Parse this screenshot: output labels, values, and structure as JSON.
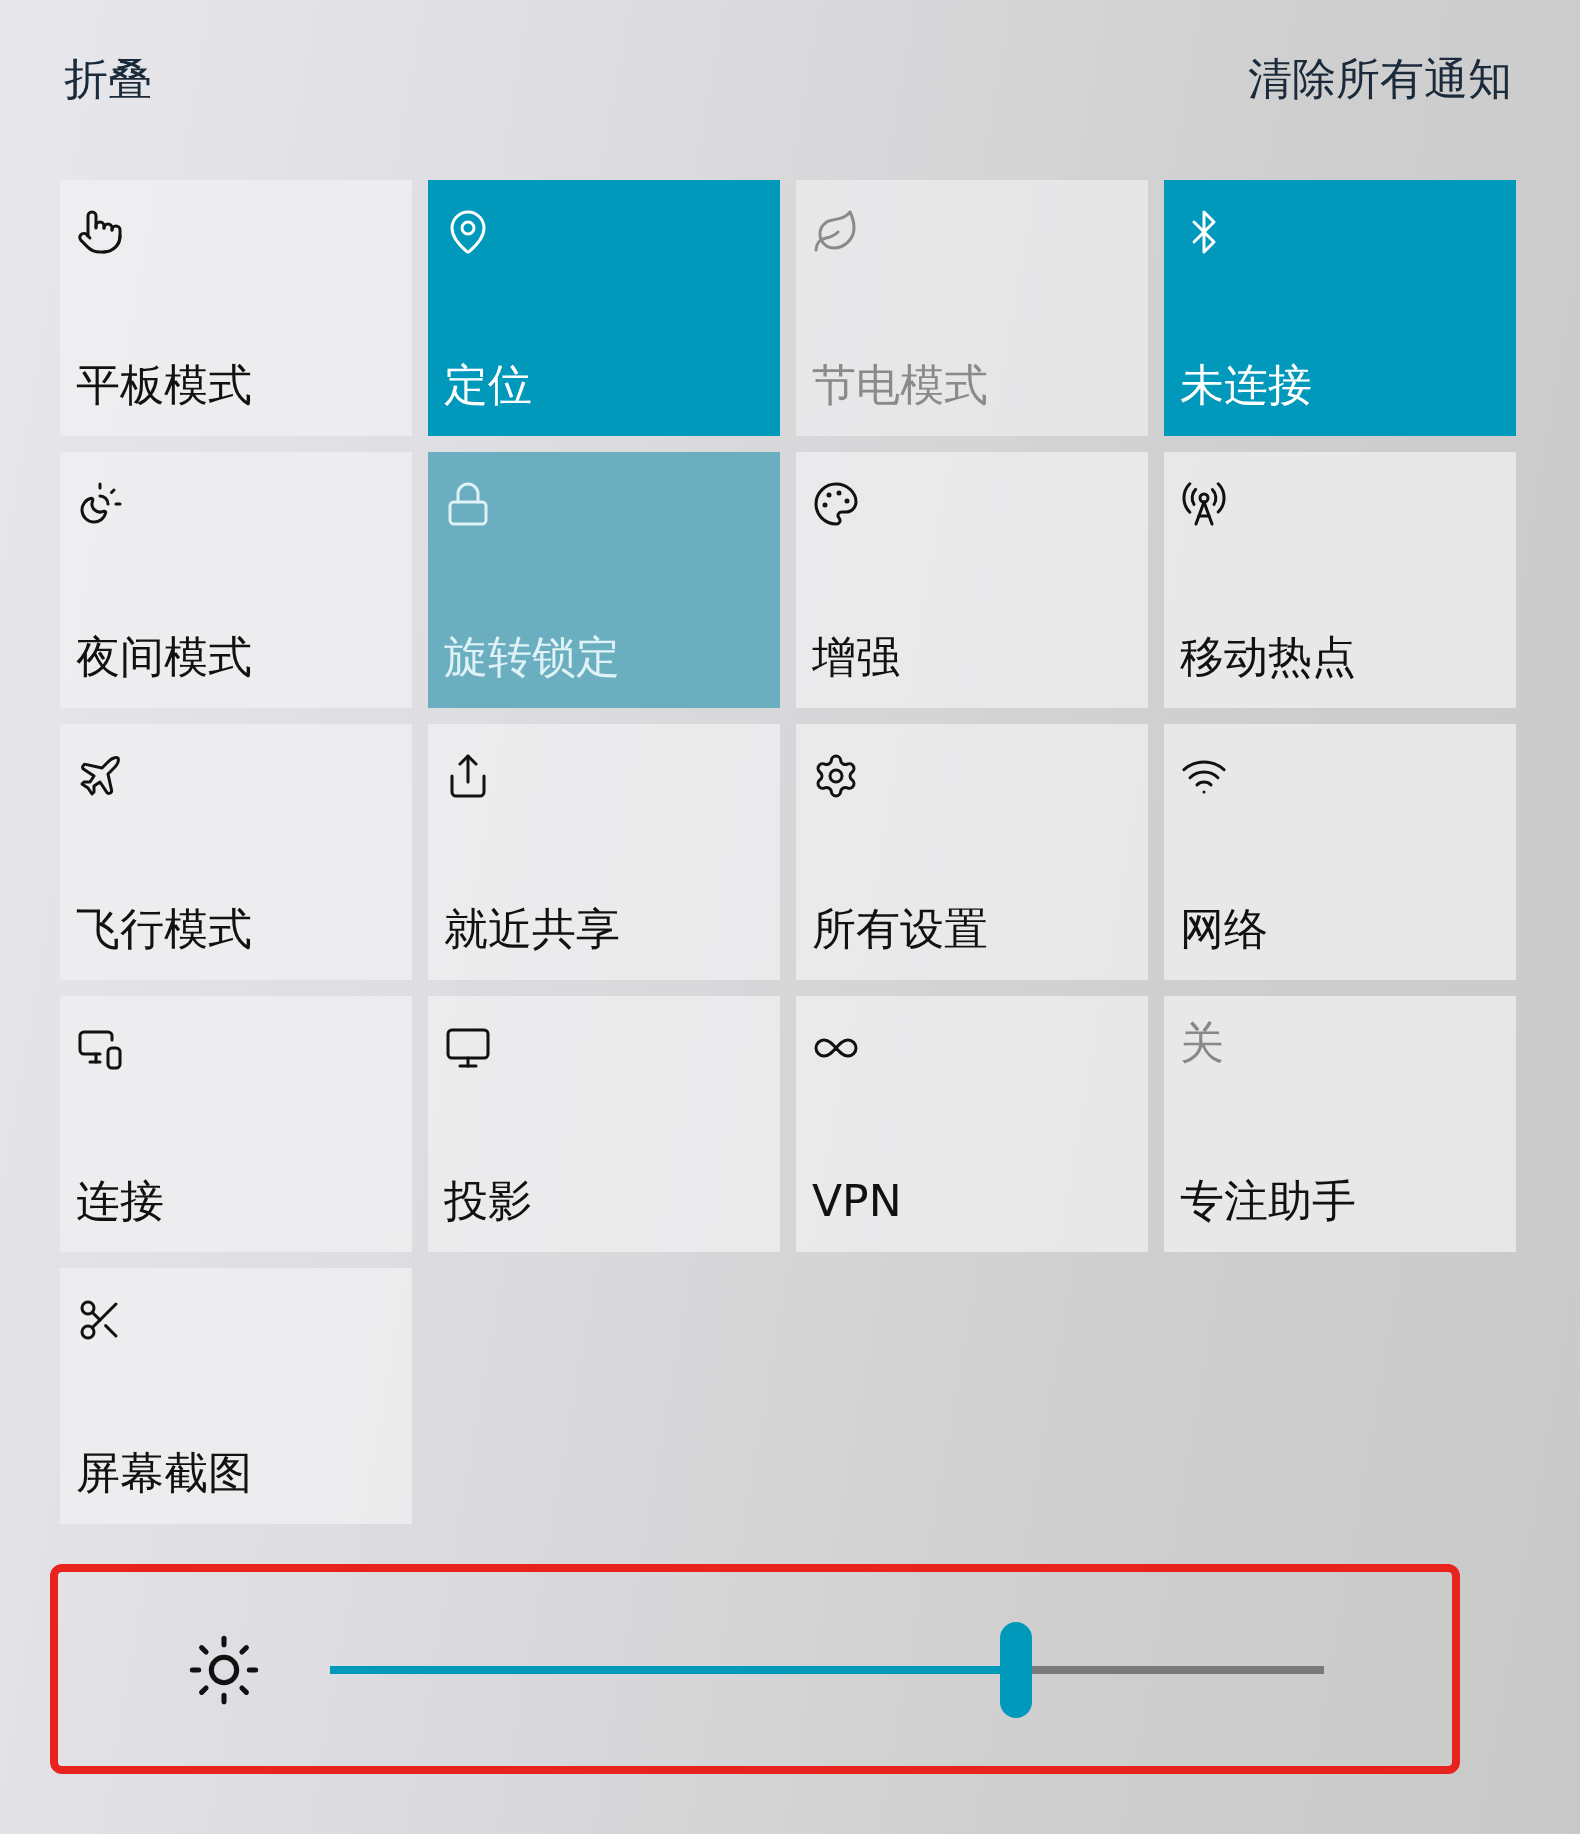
{
  "header": {
    "collapse": "折叠",
    "clear_all": "清除所有通知"
  },
  "tiles": [
    {
      "label": "平板模式",
      "on": false,
      "disabled": false
    },
    {
      "label": "定位",
      "on": true,
      "disabled": false
    },
    {
      "label": "节电模式",
      "on": false,
      "disabled": true
    },
    {
      "label": "未连接",
      "on": true,
      "disabled": false
    },
    {
      "label": "夜间模式",
      "on": false,
      "disabled": false
    },
    {
      "label": "旋转锁定",
      "on": true,
      "disabled": true
    },
    {
      "label": "增强",
      "on": false,
      "disabled": false
    },
    {
      "label": "移动热点",
      "on": false,
      "disabled": false
    },
    {
      "label": "飞行模式",
      "on": false,
      "disabled": false
    },
    {
      "label": "就近共享",
      "on": false,
      "disabled": false
    },
    {
      "label": "所有设置",
      "on": false,
      "disabled": false
    },
    {
      "label": "网络",
      "on": false,
      "disabled": false
    },
    {
      "label": "连接",
      "on": false,
      "disabled": false
    },
    {
      "label": "投影",
      "on": false,
      "disabled": false
    },
    {
      "label": "VPN",
      "on": false,
      "disabled": false
    },
    {
      "label": "专注助手",
      "on": false,
      "disabled": false,
      "icon_text": "关"
    },
    {
      "label": "屏幕截图",
      "on": false,
      "disabled": false
    }
  ],
  "brightness": {
    "level": 0.69
  }
}
